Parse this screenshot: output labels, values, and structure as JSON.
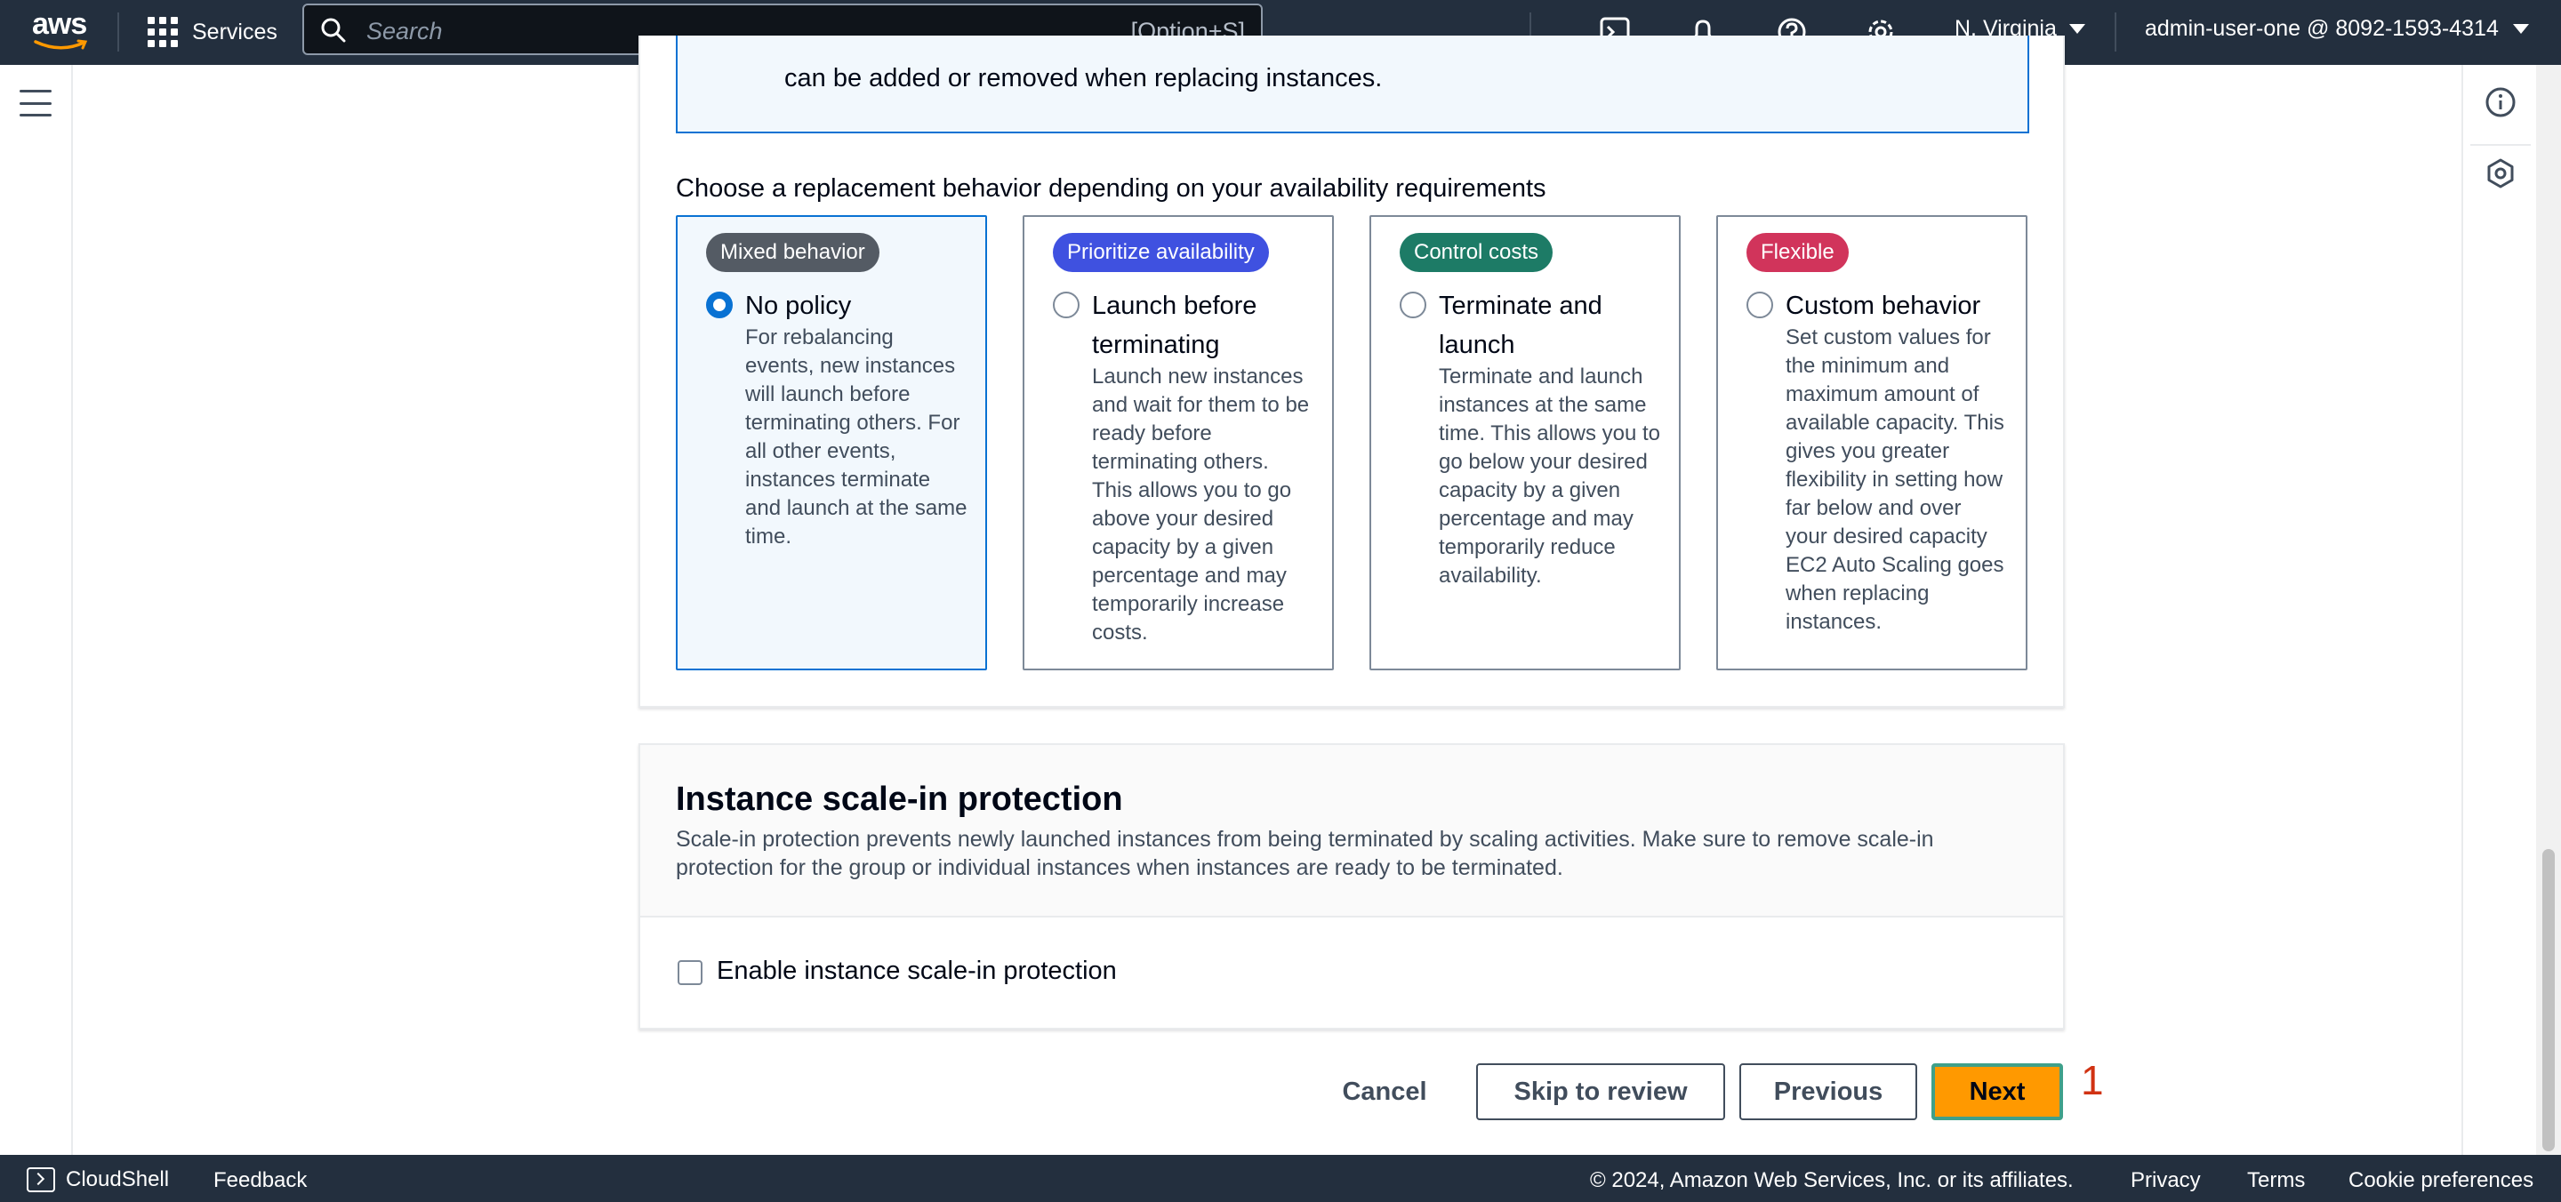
{
  "colors": {
    "nav_bg": "#232f3e",
    "primary": "#ff9900",
    "selected_border": "#0972d3",
    "badge_mixed": "#545b64",
    "badge_availability": "#3f51e0",
    "badge_costs": "#1d7b66",
    "badge_flexible": "#d1345b"
  },
  "topnav": {
    "logo_text": "aws",
    "services_label": "Services",
    "search_placeholder": "Search",
    "search_shortcut": "[Option+S]",
    "icons": [
      "cloudshell-icon",
      "bell-icon",
      "help-icon",
      "settings-icon"
    ],
    "region": "N. Virginia",
    "account": "admin-user-one @ 8092-1593-4314"
  },
  "info_alert": {
    "text": "can be added or removed when replacing instances."
  },
  "replacement": {
    "label": "Choose a replacement behavior depending on your availability requirements",
    "options": [
      {
        "badge": "Mixed behavior",
        "title": "No policy",
        "description": "For rebalancing events, new instances will launch before terminating others. For all other events, instances terminate and launch at the same time.",
        "selected": true
      },
      {
        "badge": "Prioritize availability",
        "title": "Launch before terminating",
        "description": "Launch new instances and wait for them to be ready before terminating others. This allows you to go above your desired capacity by a given percentage and may temporarily increase costs.",
        "selected": false
      },
      {
        "badge": "Control costs",
        "title": "Terminate and launch",
        "description": "Terminate and launch instances at the same time. This allows you to go below your desired capacity by a given percentage and may temporarily reduce availability.",
        "selected": false
      },
      {
        "badge": "Flexible",
        "title": "Custom behavior",
        "description": "Set custom values for the minimum and maximum amount of available capacity. This gives you greater flexibility in setting how far below and over your desired capacity EC2 Auto Scaling goes when replacing instances.",
        "selected": false
      }
    ]
  },
  "scale_in": {
    "title": "Instance scale-in protection",
    "description": "Scale-in protection prevents newly launched instances from being terminated by scaling activities. Make sure to remove scale-in protection for the group or individual instances when instances are ready to be terminated.",
    "checkbox_label": "Enable instance scale-in protection",
    "checked": false
  },
  "actions": {
    "cancel": "Cancel",
    "skip": "Skip to review",
    "previous": "Previous",
    "next": "Next",
    "marker": "1"
  },
  "footer": {
    "cloudshell": "CloudShell",
    "feedback": "Feedback",
    "copyright": "© 2024, Amazon Web Services, Inc. or its affiliates.",
    "privacy": "Privacy",
    "terms": "Terms",
    "cookie": "Cookie preferences"
  }
}
